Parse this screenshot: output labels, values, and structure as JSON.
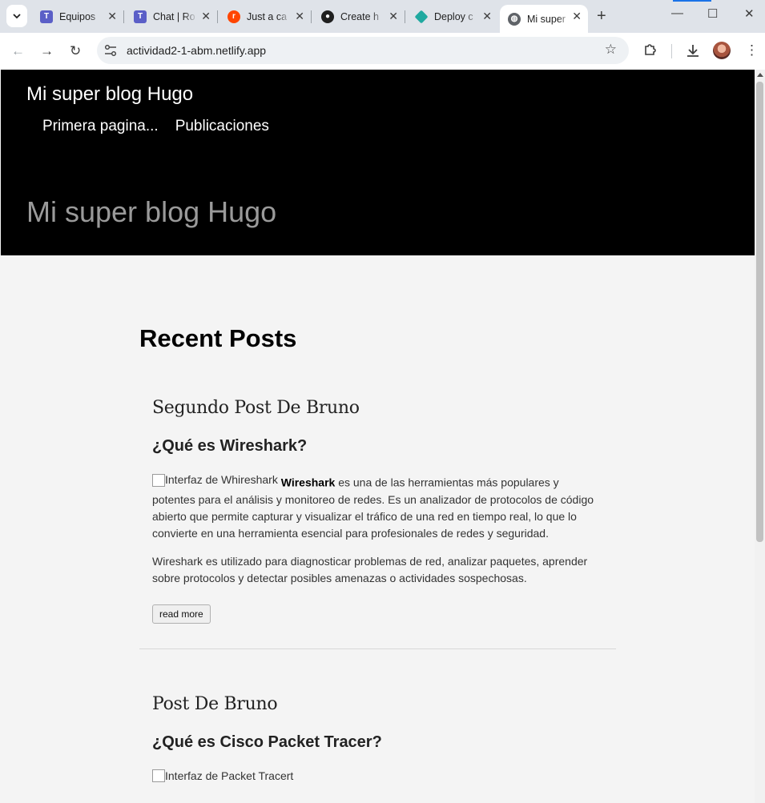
{
  "browser": {
    "tabs": [
      {
        "title": "Equipos",
        "favicon": "teams-icon",
        "color": "#5b5fc7"
      },
      {
        "title": "Chat | Ro",
        "favicon": "teams-icon",
        "color": "#5b5fc7"
      },
      {
        "title": "Just a ca",
        "favicon": "reddit-icon",
        "color": "#ff4500"
      },
      {
        "title": "Create h",
        "favicon": "github-icon",
        "color": "#1f1f1f"
      },
      {
        "title": "Deploy c",
        "favicon": "netlify-icon",
        "color": "#20a9a0"
      },
      {
        "title": "Mi super",
        "favicon": "globe-icon",
        "color": "#5f6368"
      }
    ],
    "active_tab_index": 5,
    "url": "actividad2-1-abm.netlify.app"
  },
  "site": {
    "title": "Mi super blog Hugo",
    "nav": [
      "Primera pagina...",
      "Publicaciones"
    ],
    "hero_title": "Mi super blog Hugo"
  },
  "main": {
    "section_heading": "Recent Posts",
    "posts": [
      {
        "title": "Segundo Post De Bruno",
        "subtitle": "¿Qué es Wireshark?",
        "image_alt": "Interfaz de Whireshark",
        "bold_lead": "Wireshark",
        "para1_rest": " es una de las herramientas más populares y potentes para el análisis y monitoreo de redes. Es un analizador de protocolos de código abierto que permite capturar y visualizar el tráfico de una red en tiempo real, lo que lo convierte en una herramienta esencial para profesionales de redes y seguridad.",
        "para2": "Wireshark es utilizado para diagnosticar problemas de red, analizar paquetes, aprender sobre protocolos y detectar posibles amenazas o actividades sospechosas.",
        "read_more": "read more"
      },
      {
        "title": "Post De Bruno",
        "subtitle": "¿Qué es Cisco Packet Tracer?",
        "image_alt": "Interfaz de Packet Tracert"
      }
    ]
  }
}
